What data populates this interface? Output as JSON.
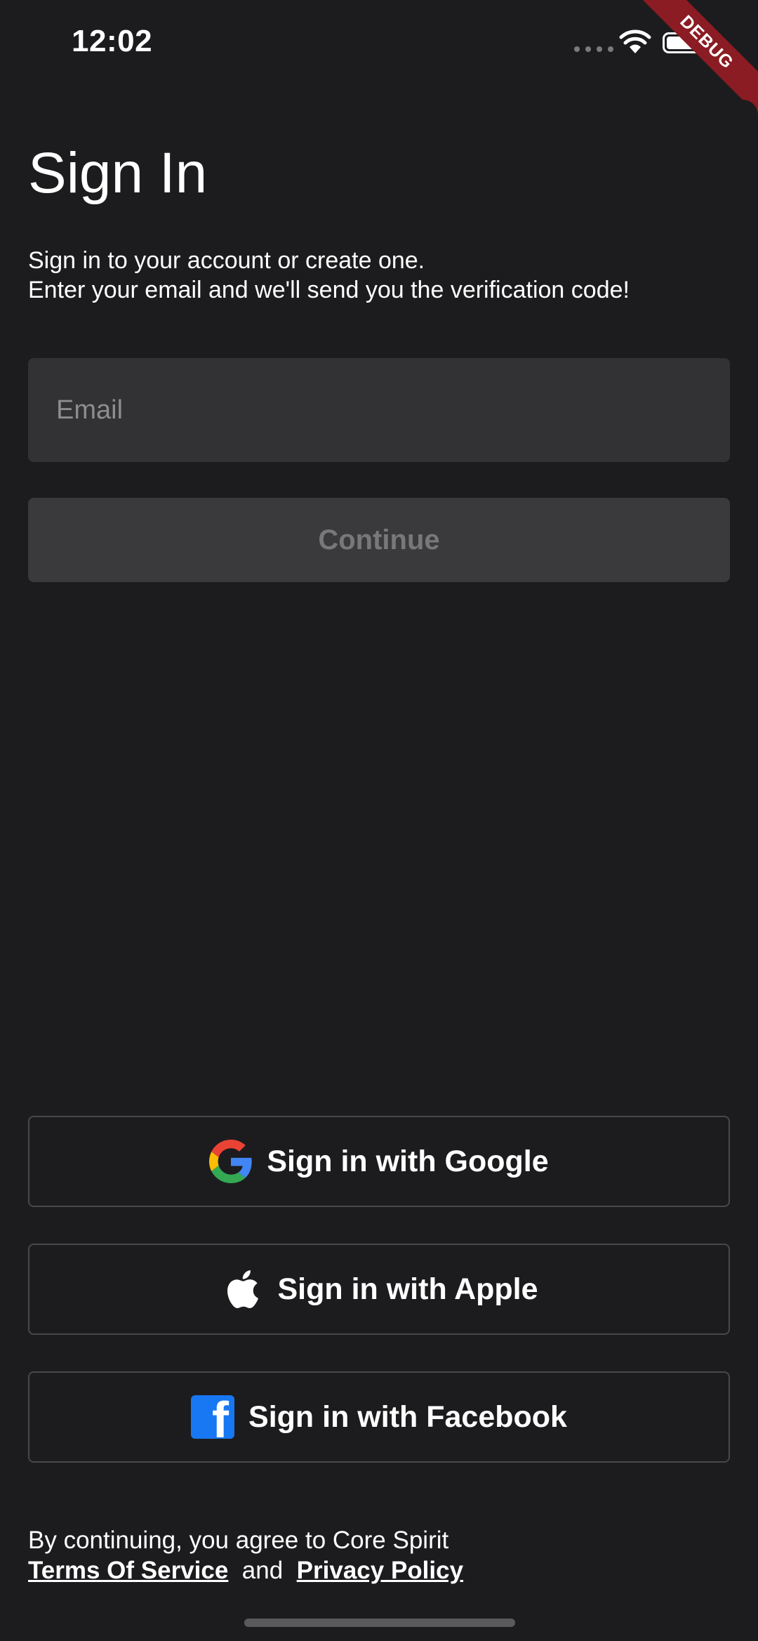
{
  "status_bar": {
    "time": "12:02",
    "debug_banner": "DEBUG"
  },
  "header": {
    "title": "Sign In",
    "subtitle_line1": "Sign in to your account or create one.",
    "subtitle_line2": "Enter your email and we'll send you the verification code!"
  },
  "form": {
    "email_placeholder": "Email",
    "email_value": "",
    "continue_label": "Continue"
  },
  "social": {
    "google_label": "Sign in with Google",
    "apple_label": "Sign in with Apple",
    "facebook_label": "Sign in with Facebook"
  },
  "legal": {
    "prefix": "By continuing, you agree to Core Spirit",
    "terms_label": "Terms Of Service",
    "joiner": "and",
    "privacy_label": "Privacy Policy"
  },
  "colors": {
    "background": "#1c1c1e",
    "input_bg": "#323234",
    "button_disabled_bg": "#3a3a3c",
    "debug_ribbon": "#8b1c23",
    "facebook_blue": "#1877f2"
  },
  "icons": [
    "wifi-icon",
    "battery-icon",
    "google-icon",
    "apple-icon",
    "facebook-icon"
  ]
}
